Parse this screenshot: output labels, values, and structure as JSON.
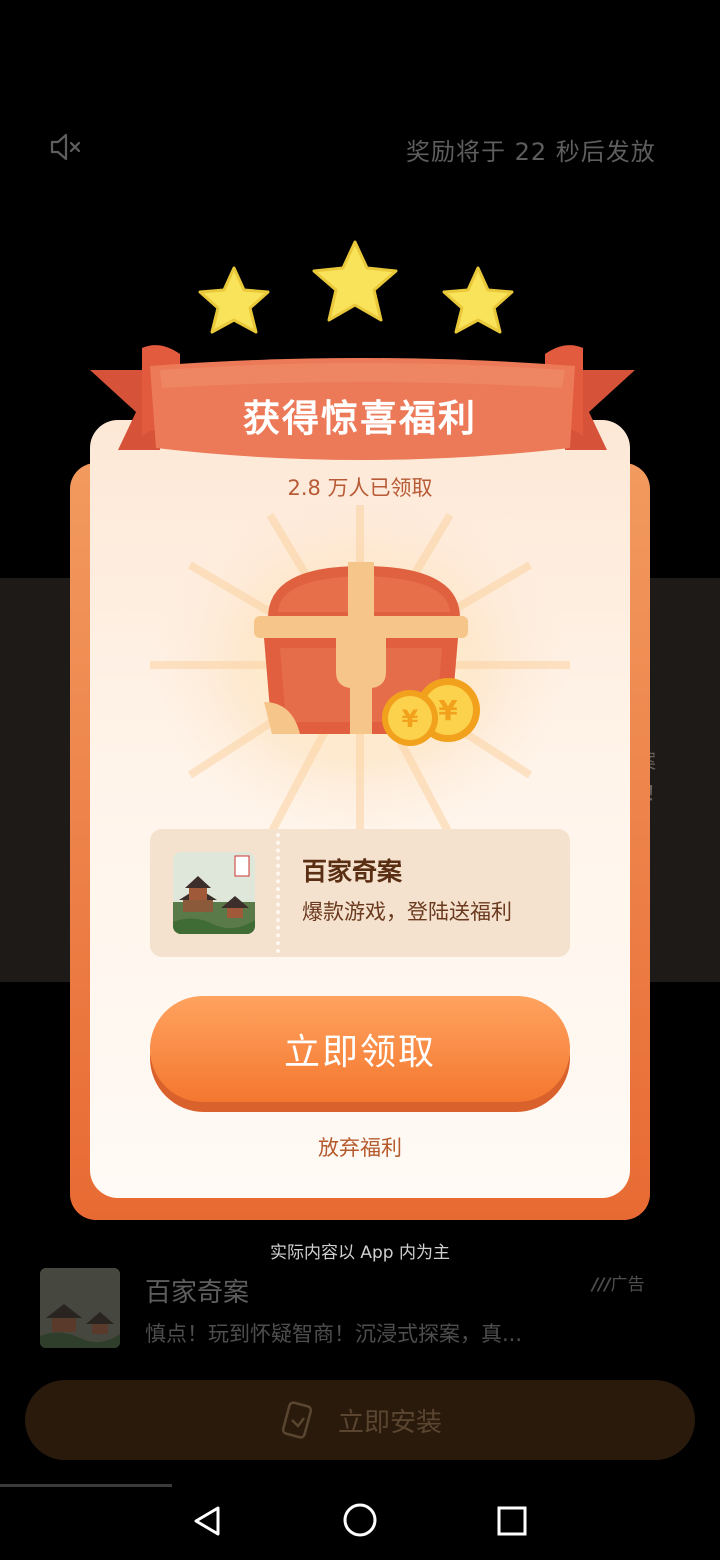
{
  "header": {
    "mute_icon": "speaker-muted-icon",
    "countdown_text": "奖励将于 22 秒后发放"
  },
  "background": {
    "fragment_line1": "案",
    "fragment_line2": "！"
  },
  "popup": {
    "title": "获得惊喜福利",
    "claimed_count": "2.8 万人已领取",
    "game": {
      "name": "百家奇案",
      "slogan": "爆款游戏，登陆送福利",
      "thumb_seal": "百家奇案"
    },
    "claim_button": "立即领取",
    "abandon_link": "放弃福利",
    "disclaimer": "实际内容以 App 内为主",
    "colors": {
      "ribbon": "#e8704e",
      "button": "#f4772f",
      "card_border": "#e86a33"
    }
  },
  "ad": {
    "app_name": "百家奇案",
    "description": "慎点！玩到怀疑智商！沉浸式探案，真...",
    "tag": "广告",
    "install_button": "立即安装"
  },
  "navbar": {
    "back_icon": "back-triangle-icon",
    "home_icon": "home-circle-icon",
    "recents_icon": "recents-square-icon"
  }
}
